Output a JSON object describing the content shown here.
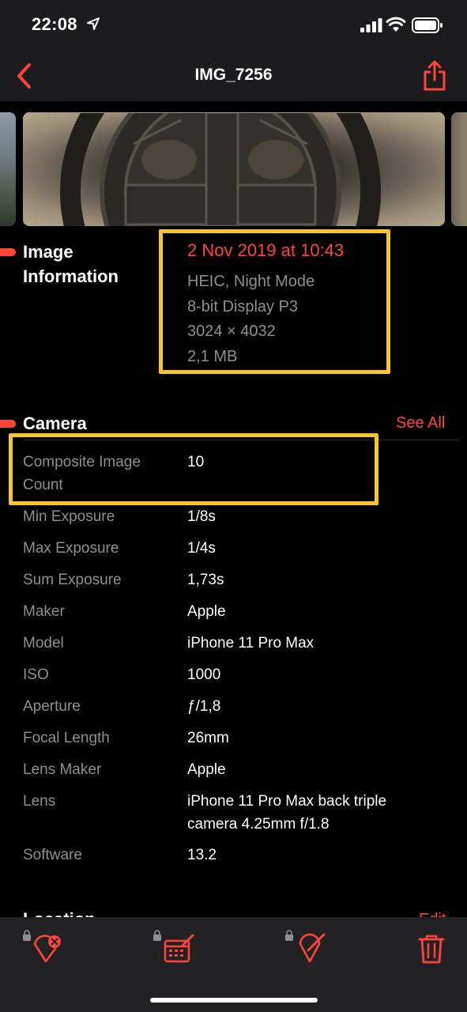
{
  "status_bar": {
    "time": "22:08"
  },
  "nav": {
    "title": "IMG_7256"
  },
  "image_info": {
    "section_title": "Image Information",
    "date": "2 Nov 2019 at 10:43",
    "format": "HEIC, Night Mode",
    "color": "8-bit Display P3",
    "dimensions": "3024 × 4032",
    "size": "2,1 MB"
  },
  "camera": {
    "section_title": "Camera",
    "see_all": "See All",
    "rows": [
      {
        "label": "Composite Image Count",
        "value": "10"
      },
      {
        "label": "Min Exposure",
        "value": "1/8s"
      },
      {
        "label": "Max Exposure",
        "value": "1/4s"
      },
      {
        "label": "Sum Exposure",
        "value": "1,73s"
      },
      {
        "label": "Maker",
        "value": "Apple"
      },
      {
        "label": "Model",
        "value": "iPhone 11 Pro Max"
      },
      {
        "label": "ISO",
        "value": "1000"
      },
      {
        "label": "Aperture",
        "value": "ƒ/1,8"
      },
      {
        "label": "Focal Length",
        "value": "26mm"
      },
      {
        "label": "Lens Maker",
        "value": "Apple"
      },
      {
        "label": "Lens",
        "value": "iPhone 11 Pro Max back triple camera 4.25mm f/1.8"
      },
      {
        "label": "Software",
        "value": "13.2"
      }
    ]
  },
  "location": {
    "section_title": "Location",
    "edit": "Edit"
  },
  "colors": {
    "accent": "#ff453a",
    "highlight": "#f7c531",
    "secondary_text": "#8e8e93"
  }
}
